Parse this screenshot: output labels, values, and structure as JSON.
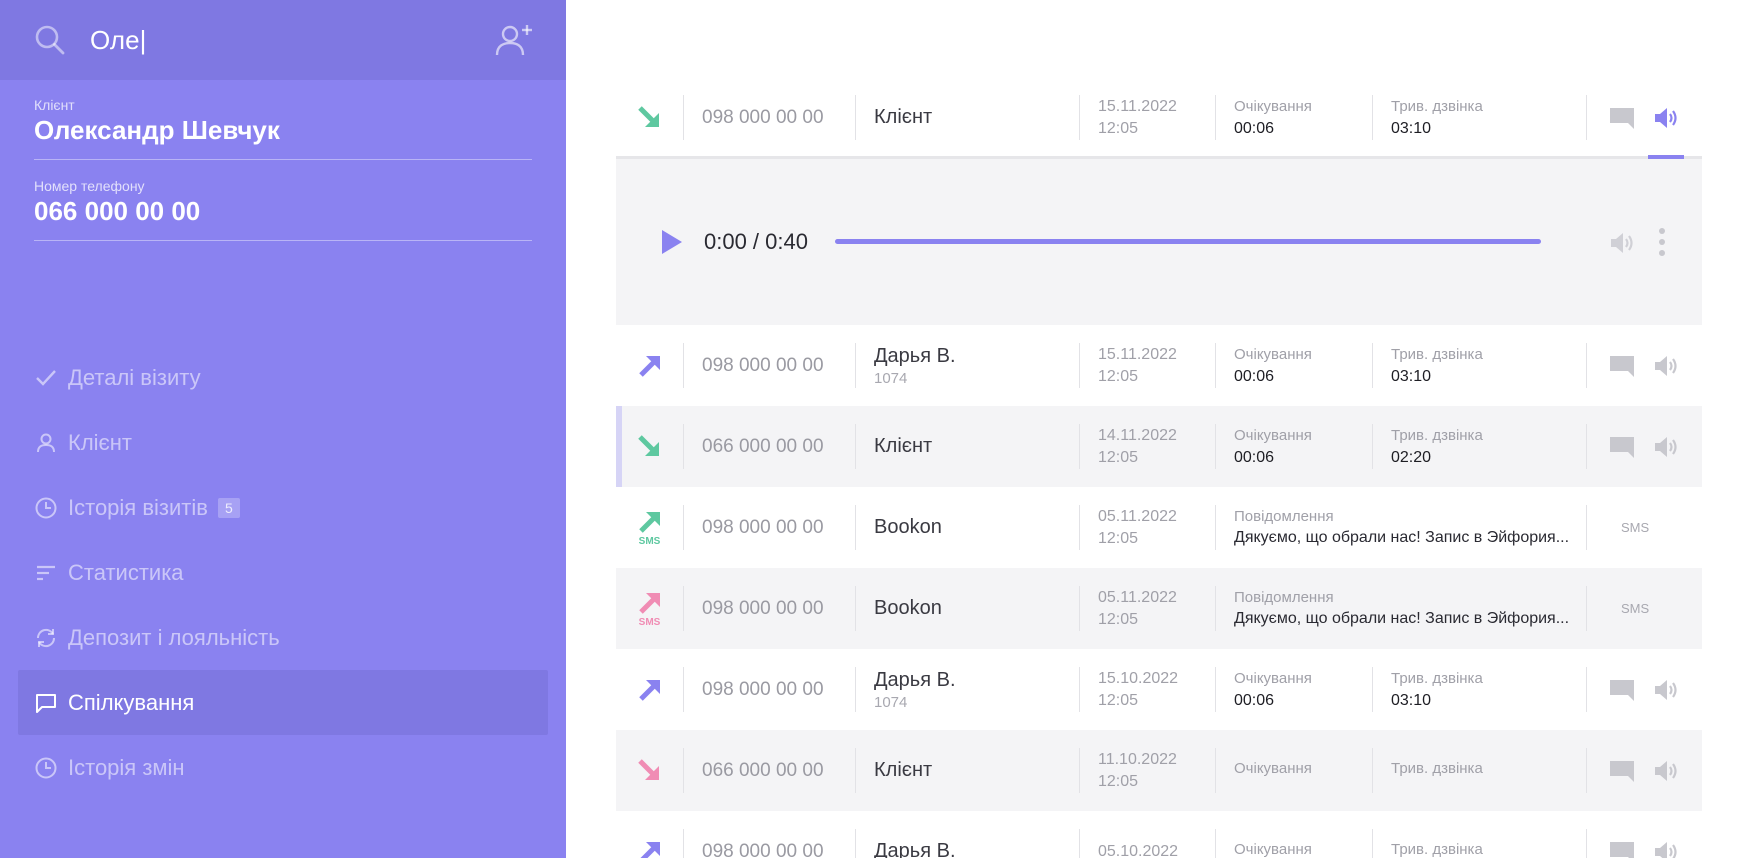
{
  "search": {
    "value": "Оле|",
    "placeholder": ""
  },
  "client_field": {
    "label": "Клієнт",
    "value": "Олександр Шевчук"
  },
  "phone_field": {
    "label": "Номер телефону",
    "value": "066 000 00 00"
  },
  "nav": [
    {
      "label": "Деталі візиту",
      "icon": "check-icon",
      "active": false
    },
    {
      "label": "Клієнт",
      "icon": "user-icon",
      "active": false
    },
    {
      "label": "Історія візитів",
      "icon": "clock-icon",
      "badge": "5",
      "active": false
    },
    {
      "label": "Статистика",
      "icon": "statistics-icon",
      "active": false
    },
    {
      "label": "Депозит і лояльність",
      "icon": "refresh-icon",
      "active": false
    },
    {
      "label": "Спілкування",
      "icon": "chat-icon",
      "active": true
    },
    {
      "label": "Історія змін",
      "icon": "clock-icon",
      "active": false
    }
  ],
  "colors": {
    "sidebar": "#8a82f0",
    "sidebar_dark": "#7f78e2",
    "incoming": "#5ec8a0",
    "outgoing": "#8a82f0",
    "missed": "#f08cb4"
  },
  "rows": [
    {
      "direction": "incoming",
      "phone": "098 000 00 00",
      "name": "Клієнт",
      "ext": "",
      "date": "15.11.2022",
      "time": "12:05",
      "wait_label": "Очікування",
      "wait": "00:06",
      "dur_label": "Трив. дзвінка",
      "dur": "03:10",
      "kind": "call"
    },
    {
      "direction": "outgoing",
      "phone": "098 000 00 00",
      "name": "Дарья В.",
      "ext": "1074",
      "date": "15.11.2022",
      "time": "12:05",
      "wait_label": "Очікування",
      "wait": "00:06",
      "dur_label": "Трив. дзвінка",
      "dur": "03:10",
      "kind": "call"
    },
    {
      "direction": "incoming",
      "phone": "066 000 00 00",
      "name": "Клієнт",
      "ext": "",
      "date": "14.11.2022",
      "time": "12:05",
      "wait_label": "Очікування",
      "wait": "00:06",
      "dur_label": "Трив. дзвінка",
      "dur": "02:20",
      "kind": "call"
    },
    {
      "direction": "sms-out",
      "phone": "098 000 00 00",
      "name": "Bookon",
      "ext": "",
      "date": "05.11.2022",
      "time": "12:05",
      "msg_label": "Повідомлення",
      "msg": "Дякуємо, що обрали нас! Запис в Эйфория...",
      "sms_label": "SMS",
      "sms_tag": "SMS",
      "kind": "sms"
    },
    {
      "direction": "sms-failed",
      "phone": "098 000 00 00",
      "name": "Bookon",
      "ext": "",
      "date": "05.11.2022",
      "time": "12:05",
      "msg_label": "Повідомлення",
      "msg": "Дякуємо, що обрали нас! Запис в Эйфория...",
      "sms_label": "SMS",
      "sms_tag": "SMS",
      "kind": "sms"
    },
    {
      "direction": "outgoing",
      "phone": "098 000 00 00",
      "name": "Дарья В.",
      "ext": "1074",
      "date": "15.10.2022",
      "time": "12:05",
      "wait_label": "Очікування",
      "wait": "00:06",
      "dur_label": "Трив. дзвінка",
      "dur": "03:10",
      "kind": "call"
    },
    {
      "direction": "missed",
      "phone": "066 000 00 00",
      "name": "Клієнт",
      "ext": "",
      "date": "11.10.2022",
      "time": "12:05",
      "wait_label": "Очікування",
      "wait": "",
      "dur_label": "Трив. дзвінка",
      "dur": "",
      "kind": "call"
    },
    {
      "direction": "outgoing",
      "phone": "098 000 00 00",
      "name": "Дарья В.",
      "ext": "",
      "date": "05.10.2022",
      "time": "",
      "wait_label": "Очікування",
      "wait": "",
      "dur_label": "Трив. дзвінка",
      "dur": "",
      "kind": "call"
    }
  ],
  "player": {
    "time": "0:00 / 0:40",
    "progress": 0
  }
}
